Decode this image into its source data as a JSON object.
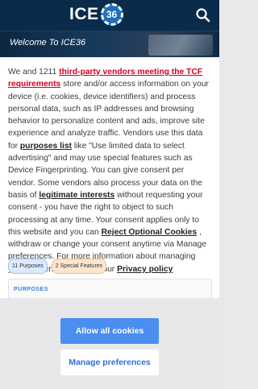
{
  "header": {
    "logo_text": "ICE",
    "logo_chip": "36",
    "search_icon": "search-icon",
    "background": "#0b2b4a"
  },
  "hero": {
    "title": "Welcome To ICE36"
  },
  "consent": {
    "t1": "We and 1211 ",
    "link_vendors": "third-party vendors meeting the TCF requirements",
    "t2": " store and/or access information on your device (i.e. cookies, device identifiers) and process personal data, such as IP addresses and browsing behavior to personalize content and ads, improve site experience and analyze traffic. Vendors use this data for ",
    "link_purposes": "purposes list",
    "t3": "  like \"Use limited data to select advertising\" and may use special features such as Device Fingerprinting. You can give consent per vendor. Some vendors also process your data on the basis of ",
    "link_legit": "legitimate interests",
    "t4": "  without requesting your consent - you have the right to object to such processing at any time. Your consent applies only to this website and you can ",
    "link_reject": "Reject Optional Cookies",
    "t5": " , withdraw or change your consent anytime via Manage preferences. For more information about managing your consent, please see our ",
    "link_privacy": "Privacy policy",
    "tag_purposes": "11 Purposes",
    "tag_features": "2 Special Features",
    "purposes_heading": "PURPOSES",
    "allow_all_label": "Allow all cookies",
    "manage_label": "Manage preferences",
    "accent": "#4a8ef0",
    "link_red": "#d3001f"
  }
}
